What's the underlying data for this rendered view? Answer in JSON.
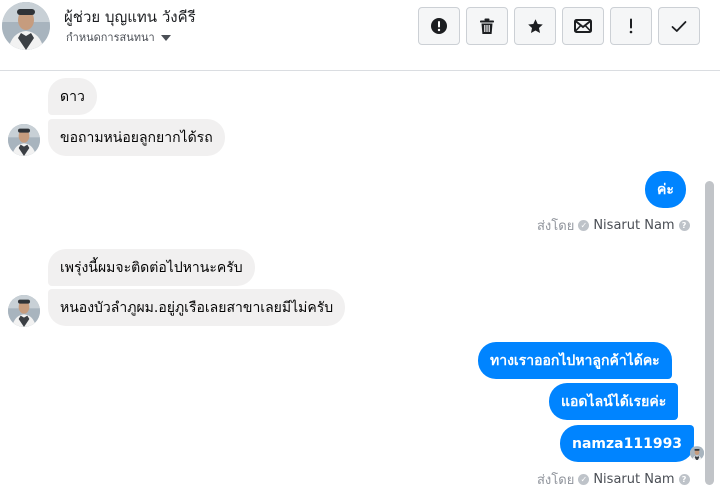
{
  "header": {
    "name": "ผู้ช่วย บุญแทน วังคีรี",
    "subtitle": "กำหนดการสนทนา",
    "actions": [
      {
        "name": "report-button",
        "icon": "alert-circle-icon"
      },
      {
        "name": "delete-button",
        "icon": "trash-icon"
      },
      {
        "name": "star-button",
        "icon": "star-icon"
      },
      {
        "name": "mark-unread-button",
        "icon": "envelope-icon"
      },
      {
        "name": "important-button",
        "icon": "exclamation-icon"
      },
      {
        "name": "done-button",
        "icon": "checkmark-icon"
      }
    ]
  },
  "messages": [
    {
      "side": "in",
      "text": "ดาว"
    },
    {
      "side": "in",
      "text": "ขอถามหน่อยลูกยากได้รถ"
    },
    {
      "side": "out",
      "text": "ค่ะ"
    },
    {
      "side": "in",
      "text": "เพรุ่งนี้ผมจะติดต่อไปหานะครับ"
    },
    {
      "side": "in",
      "text": "หนองบัวลำภูผม.อยู่ภูเรือเลยสาขาเลยมีไม่ครับ"
    },
    {
      "side": "out",
      "text": "ทางเราออกไปหาลูกค้าได้คะ"
    },
    {
      "side": "out",
      "text": "แอดไลน์ได้เรยค่ะ"
    },
    {
      "side": "out",
      "text": "namza111993"
    }
  ],
  "sent_by": {
    "prefix": "ส่งโดย",
    "name": "Nisarut Nam",
    "help": "?"
  },
  "colors": {
    "accent": "#0084ff",
    "incoming_bubble": "#f1f0f0",
    "border": "#ccd0d5"
  }
}
